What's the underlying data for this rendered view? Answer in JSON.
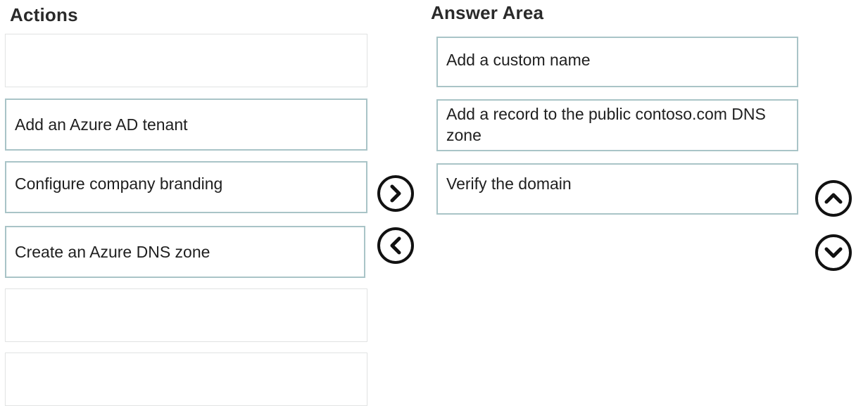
{
  "actions": {
    "heading": "Actions",
    "items": [
      "",
      "Add an Azure AD tenant",
      "Configure company branding",
      "Create an Azure DNS zone",
      "",
      ""
    ]
  },
  "answer_area": {
    "heading": "Answer Area",
    "items": [
      "Add a custom name",
      "Add a record to the public contoso.com DNS zone",
      "Verify the domain"
    ]
  },
  "controls": {
    "move_right_icon": "chevron-right-icon",
    "move_left_icon": "chevron-left-icon",
    "move_up_icon": "chevron-up-icon",
    "move_down_icon": "chevron-down-icon"
  },
  "colors": {
    "slot_border": "#a9c4c7",
    "empty_slot_border": "#e2e4e4",
    "button_stroke": "#111111"
  }
}
